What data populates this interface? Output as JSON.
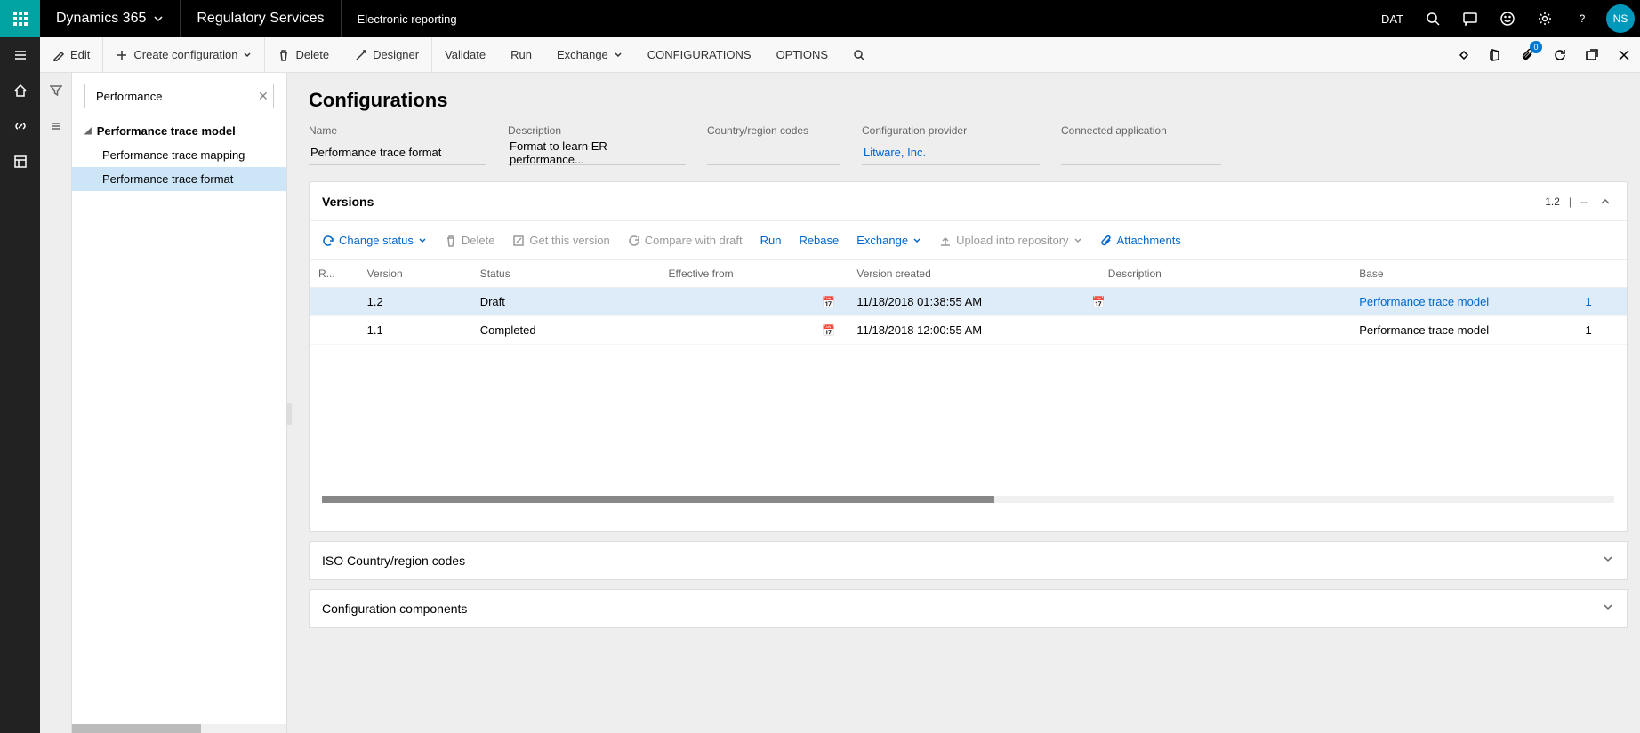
{
  "topbar": {
    "brand": "Dynamics 365",
    "app": "Regulatory Services",
    "crumb": "Electronic reporting",
    "company": "DAT",
    "user_initials": "NS"
  },
  "actionbar": {
    "edit": "Edit",
    "create": "Create configuration",
    "delete": "Delete",
    "designer": "Designer",
    "validate": "Validate",
    "run": "Run",
    "exchange": "Exchange",
    "configurations": "CONFIGURATIONS",
    "options": "OPTIONS",
    "badge_count": "0"
  },
  "tree": {
    "search_value": "Performance",
    "root": "Performance trace model",
    "children": [
      "Performance trace mapping",
      "Performance trace format"
    ]
  },
  "page": {
    "title": "Configurations",
    "fields": {
      "name_label": "Name",
      "name_value": "Performance trace format",
      "desc_label": "Description",
      "desc_value": "Format to learn ER performance...",
      "country_label": "Country/region codes",
      "country_value": "",
      "provider_label": "Configuration provider",
      "provider_value": "Litware, Inc.",
      "connapp_label": "Connected application",
      "connapp_value": ""
    }
  },
  "versions": {
    "title": "Versions",
    "current": "1.2",
    "dash": "--",
    "toolbar": {
      "change_status": "Change status",
      "delete": "Delete",
      "get_version": "Get this version",
      "compare": "Compare with draft",
      "run": "Run",
      "rebase": "Rebase",
      "exchange": "Exchange",
      "upload": "Upload into repository",
      "attachments": "Attachments"
    },
    "columns": {
      "r": "R...",
      "version": "Version",
      "status": "Status",
      "effective": "Effective from",
      "created": "Version created",
      "description": "Description",
      "base": "Base",
      "basever": ""
    },
    "rows": [
      {
        "version": "1.2",
        "status": "Draft",
        "effective": "",
        "created": "11/18/2018 01:38:55 AM",
        "description": "",
        "base": "Performance trace model",
        "basever": "1",
        "selected": true
      },
      {
        "version": "1.1",
        "status": "Completed",
        "effective": "",
        "created": "11/18/2018 12:00:55 AM",
        "description": "",
        "base": "Performance trace model",
        "basever": "1",
        "selected": false
      }
    ]
  },
  "cards": {
    "iso": "ISO Country/region codes",
    "components": "Configuration components"
  }
}
